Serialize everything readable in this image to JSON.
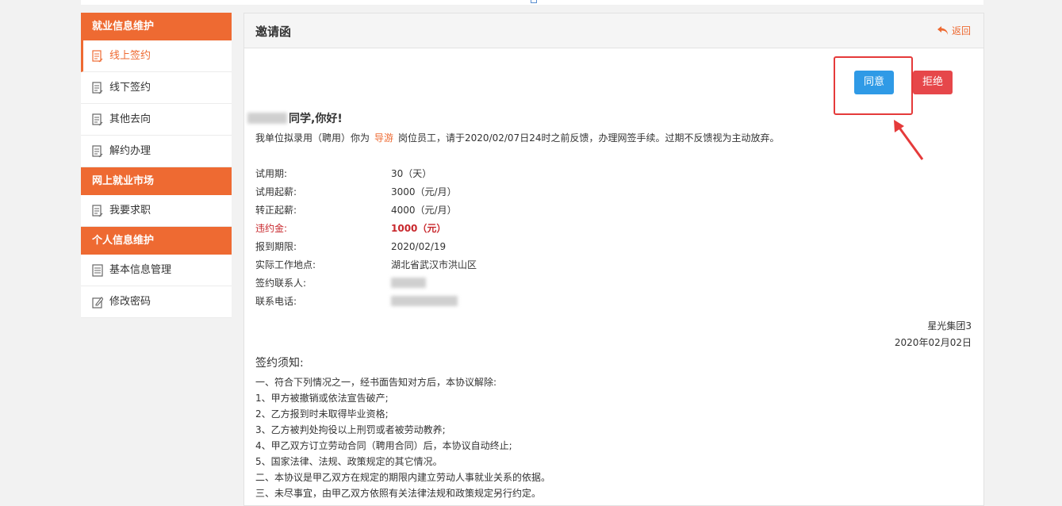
{
  "sidebar": {
    "sections": [
      {
        "title": "就业信息维护",
        "items": [
          {
            "label": "线上签约",
            "icon": "document-icon",
            "active": true
          },
          {
            "label": "线下签约",
            "icon": "document-icon"
          },
          {
            "label": "其他去向",
            "icon": "document-icon"
          },
          {
            "label": "解约办理",
            "icon": "document-icon"
          }
        ]
      },
      {
        "title": "网上就业市场",
        "items": [
          {
            "label": "我要求职",
            "icon": "document-icon"
          }
        ]
      },
      {
        "title": "个人信息维护",
        "items": [
          {
            "label": "基本信息管理",
            "icon": "list-document-icon"
          },
          {
            "label": "修改密码",
            "icon": "edit-icon"
          }
        ]
      }
    ]
  },
  "panel": {
    "title": "邀请函",
    "back_label": "返回",
    "agree_label": "同意",
    "reject_label": "拒绝"
  },
  "letter": {
    "greeting_suffix": "同学,你好!",
    "intro_prefix": "我单位拟录用（聘用）你为",
    "position": "导游",
    "intro_suffix": "岗位员工，请于2020/02/07日24时之前反馈，办理网签手续。过期不反馈视为主动放弃。",
    "info": [
      {
        "label": "试用期:",
        "value": "30（天）"
      },
      {
        "label": "试用起薪:",
        "value": "3000（元/月）"
      },
      {
        "label": "转正起薪:",
        "value": "4000（元/月）"
      },
      {
        "label": "违约金:",
        "value": "1000（元）",
        "highlight": true
      },
      {
        "label": "报到期限:",
        "value": "2020/02/19"
      },
      {
        "label": "实际工作地点:",
        "value": "湖北省武汉市洪山区"
      },
      {
        "label": "签约联系人:",
        "value": ""
      },
      {
        "label": "联系电话:",
        "value": ""
      }
    ],
    "company": "星光集团3",
    "date": "2020年02月02日"
  },
  "notice": {
    "title": "签约须知:",
    "lines": [
      "一、符合下列情况之一，经书面告知对方后，本协议解除:",
      "1、甲方被撤销或依法宣告破产;",
      "2、乙方报到时未取得毕业资格;",
      "3、乙方被判处拘役以上刑罚或者被劳动教养;",
      "4、甲乙双方订立劳动合同（聘用合同）后，本协议自动终止;",
      "5、国家法律、法规、政策规定的其它情况。",
      "二、本协议是甲乙双方在规定的期限内建立劳动人事就业关系的依据。",
      "三、未尽事宜，由甲乙双方依照有关法律法规和政策规定另行约定。"
    ]
  },
  "colors": {
    "accent": "#ee6a32",
    "agree": "#2f9ae6",
    "reject": "#e6474a",
    "penalty": "#c8272c",
    "annotation": "#e53a3a"
  }
}
